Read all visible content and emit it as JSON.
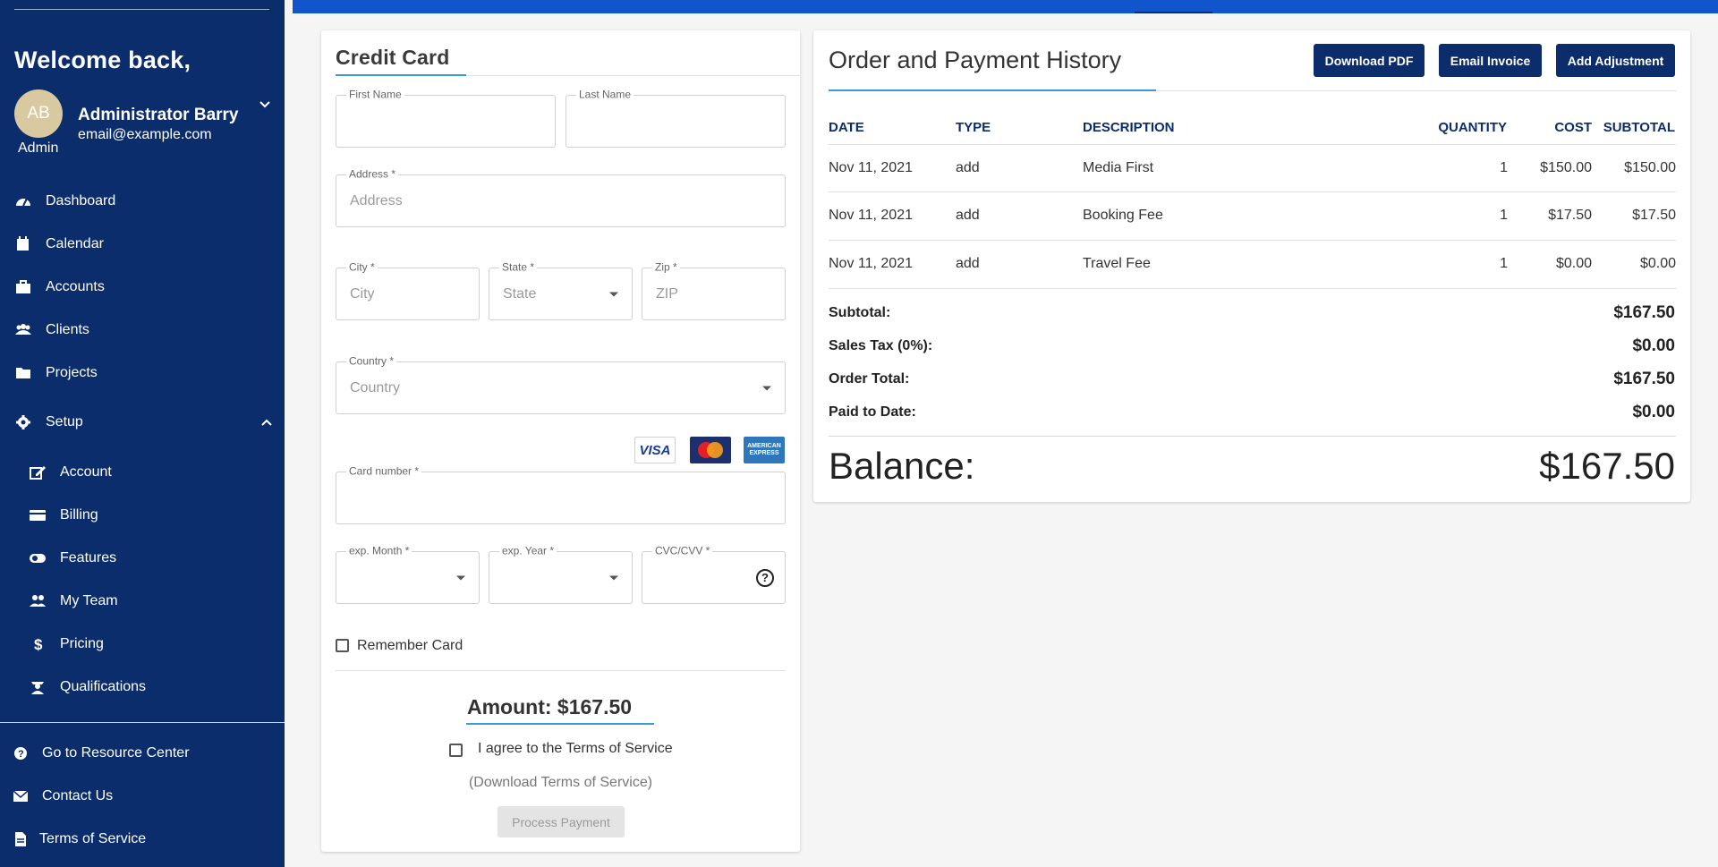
{
  "sidebar": {
    "welcome": "Welcome back,",
    "user": {
      "initials": "AB",
      "name": "Administrator Barry",
      "email": "email@example.com",
      "role": "Admin"
    },
    "nav": [
      {
        "label": "Dashboard",
        "icon": "dashboard-icon"
      },
      {
        "label": "Calendar",
        "icon": "calendar-icon"
      },
      {
        "label": "Accounts",
        "icon": "briefcase-icon"
      },
      {
        "label": "Clients",
        "icon": "people-icon"
      },
      {
        "label": "Projects",
        "icon": "folder-icon"
      },
      {
        "label": "Setup",
        "icon": "gear-icon"
      }
    ],
    "setup_items": [
      {
        "label": "Account",
        "icon": "edit-icon"
      },
      {
        "label": "Billing",
        "icon": "credit-card-icon"
      },
      {
        "label": "Features",
        "icon": "toggle-icon"
      },
      {
        "label": "My Team",
        "icon": "team-icon"
      },
      {
        "label": "Pricing",
        "icon": "dollar-icon"
      },
      {
        "label": "Qualifications",
        "icon": "graduate-icon"
      }
    ],
    "footer": [
      {
        "label": "Go to Resource Center",
        "icon": "help-circle-icon"
      },
      {
        "label": "Contact Us",
        "icon": "mail-icon"
      },
      {
        "label": "Terms of Service",
        "icon": "document-icon"
      }
    ]
  },
  "credit_card": {
    "title": "Credit Card",
    "first_name_label": "First Name",
    "last_name_label": "Last Name",
    "address_label": "Address *",
    "address_placeholder": "Address",
    "city_label": "City *",
    "city_placeholder": "City",
    "state_label": "State *",
    "state_placeholder": "State",
    "zip_label": "Zip *",
    "zip_placeholder": "ZIP",
    "country_label": "Country *",
    "country_placeholder": "Country",
    "card_number_label": "Card number *",
    "exp_month_label": "exp. Month *",
    "exp_year_label": "exp. Year *",
    "cvc_label": "CVC/CVV *",
    "card_brands": {
      "visa": "VISA",
      "amex": "AMERICAN EXPRESS"
    },
    "remember_label": "Remember Card",
    "amount": "Amount: $167.50",
    "agree_label": "I agree to the Terms of Service",
    "download_tos": "(Download Terms of Service)",
    "process_button": "Process Payment"
  },
  "order_history": {
    "title": "Order and Payment History",
    "buttons": {
      "download_pdf": "Download PDF",
      "email_invoice": "Email Invoice",
      "add_adjustment": "Add Adjustment"
    },
    "columns": [
      "DATE",
      "TYPE",
      "DESCRIPTION",
      "QUANTITY",
      "COST",
      "SUBTOTAL"
    ],
    "rows": [
      [
        "Nov 11, 2021",
        "add",
        "Media First",
        "1",
        "$150.00",
        "$150.00"
      ],
      [
        "Nov 11, 2021",
        "add",
        "Booking Fee",
        "1",
        "$17.50",
        "$17.50"
      ],
      [
        "Nov 11, 2021",
        "add",
        "Travel Fee",
        "1",
        "$0.00",
        "$0.00"
      ]
    ],
    "summary": [
      {
        "label": "Subtotal:",
        "value": "$167.50"
      },
      {
        "label": "Sales Tax (0%):",
        "value": "$0.00"
      },
      {
        "label": "Order Total:",
        "value": "$167.50"
      },
      {
        "label": "Paid to Date:",
        "value": "$0.00"
      }
    ],
    "balance_label": "Balance:",
    "balance_value": "$167.50"
  },
  "colors": {
    "sidebar": "#0b2d6b",
    "topbar": "#1155cc",
    "accent": "#3a9ad9"
  }
}
